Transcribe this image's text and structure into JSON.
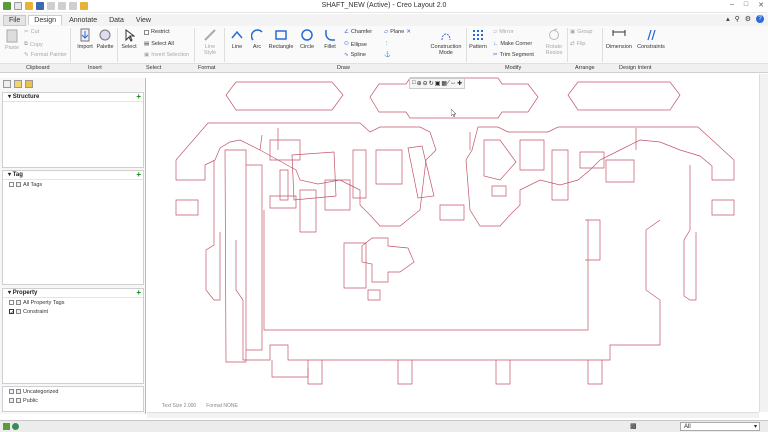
{
  "window": {
    "title": "SHAFT_NEW (Active) - Creo Layout 2.0"
  },
  "menu": {
    "tabs": [
      "File",
      "Design",
      "Annotate",
      "Data",
      "View"
    ]
  },
  "ribbon": {
    "clipboard": {
      "paste": "Paste",
      "cut": "Cut",
      "copy": "Copy",
      "format_painter": "Format Painter",
      "label": "Clipboard"
    },
    "insert": {
      "import": "Import",
      "palette": "Palette",
      "label": "Insert"
    },
    "select": {
      "select": "Select",
      "restrict": "Restrict",
      "select_all": "Select All",
      "invert": "Invert Selection",
      "label": "Select"
    },
    "format": {
      "line_style": "Line Style",
      "label": "Format"
    },
    "draw": {
      "line": "Line",
      "arc": "Arc",
      "rectangle": "Rectangle",
      "circle": "Circle",
      "fillet": "Fillet",
      "chamfer": "Chamfer",
      "ellipse": "Ellipse",
      "spline": "Spline",
      "plane": "Plane",
      "construction_mode": "Construction Mode",
      "label": "Draw"
    },
    "modify": {
      "pattern": "Pattern",
      "mirror": "Mirror",
      "make_corner": "Make Corner",
      "trim_segment": "Trim Segment",
      "rotate_resize": "Rotate Resize",
      "label": "Modify"
    },
    "arrange": {
      "group": "Group",
      "flip": "Flip",
      "label": "Arrange"
    },
    "design_intent": {
      "dimension": "Dimension",
      "constraints": "Constraints",
      "label": "Design Intent"
    }
  },
  "panel": {
    "structure": {
      "title": "Structure"
    },
    "tag": {
      "title": "Tag",
      "items": [
        "All Tags"
      ]
    },
    "property": {
      "title": "Property",
      "items": [
        "All Property Tags",
        "Constraint"
      ]
    },
    "layers": {
      "items": [
        "Uncategorized",
        "Public"
      ]
    }
  },
  "viewport": {
    "text_size": "Text Size 2.000",
    "format": "Format NONE"
  },
  "statusbar": {
    "filter": "All"
  },
  "colors": {
    "sketch_line": "#c2566a",
    "accent": "#2a6ad4"
  }
}
